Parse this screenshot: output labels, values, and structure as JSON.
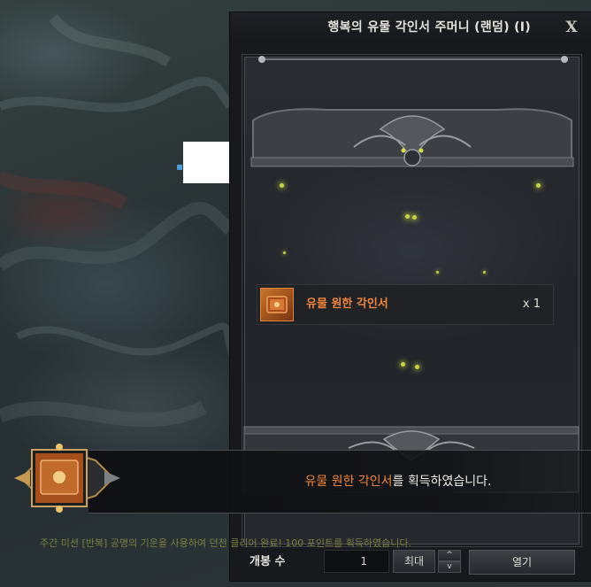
{
  "window": {
    "title": "행복의 유물 각인서 주머니 (랜덤) (I)",
    "close_label": "X"
  },
  "rewards": [
    {
      "name": "유물 원한 각인서",
      "quantity": "x 1",
      "icon": "engraving-book-icon",
      "color": "#f0853a"
    }
  ],
  "controls": {
    "open_count_label": "개봉 수",
    "quantity_value": "1",
    "max_label": "최대",
    "up_symbol": "^",
    "down_symbol": "v",
    "open_label": "열기"
  },
  "notification": {
    "item_name": "유물 원한 각인서",
    "suffix": "를 획득하였습니다."
  },
  "mission_message": "주간 미션 [반복] 공명의 기운을 사용하여 던전 클리어 완료! 100 포인트를 획득하였습니다.",
  "colors": {
    "relic_orange": "#f0853a",
    "panel_bg": "#17191c",
    "spark": "#c7d34a"
  }
}
